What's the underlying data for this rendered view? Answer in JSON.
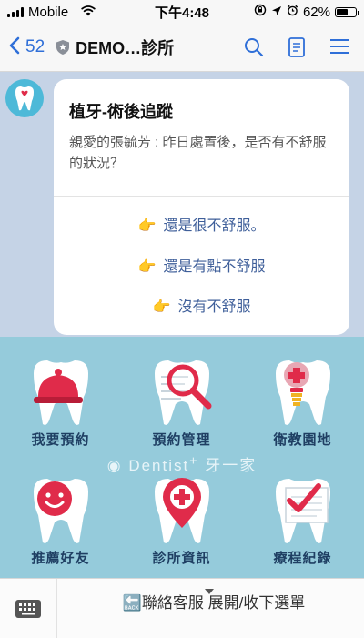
{
  "status": {
    "carrier": "Mobile",
    "time": "下午4:48",
    "battery": "62%",
    "battery_level": 0.62
  },
  "nav": {
    "back_count": "52",
    "title": "DEMO…診所"
  },
  "message": {
    "title": "植牙-術後追蹤",
    "body": "親愛的張毓芳 : 昨日處置後，是否有不舒服的狀況？",
    "options": [
      {
        "icon": "👉",
        "label": "還是很不舒服。"
      },
      {
        "icon": "👉",
        "label": "還是有點不舒服"
      },
      {
        "icon": "👉",
        "label": "沒有不舒服"
      }
    ]
  },
  "rich_menu": {
    "brand_latin": "Dentist",
    "brand_plus": "+",
    "brand_cjk": "牙一家",
    "tiles": [
      {
        "label": "我要預約",
        "icon": "service-bell-icon"
      },
      {
        "label": "預約管理",
        "icon": "magnifier-icon"
      },
      {
        "label": "衛教園地",
        "icon": "implant-icon"
      },
      {
        "label": "推薦好友",
        "icon": "smiley-icon"
      },
      {
        "label": "診所資訊",
        "icon": "location-cross-icon"
      },
      {
        "label": "療程紀錄",
        "icon": "checklist-icon"
      }
    ]
  },
  "bottom": {
    "toggle_label": "🔙聯絡客服 展開/收下選單"
  },
  "colors": {
    "accent": "#2f6fd8",
    "menu_bg": "#95cbdb",
    "chat_bg": "#c5d3e6",
    "tooth": "#ffffff",
    "red": "#e02b4a"
  }
}
